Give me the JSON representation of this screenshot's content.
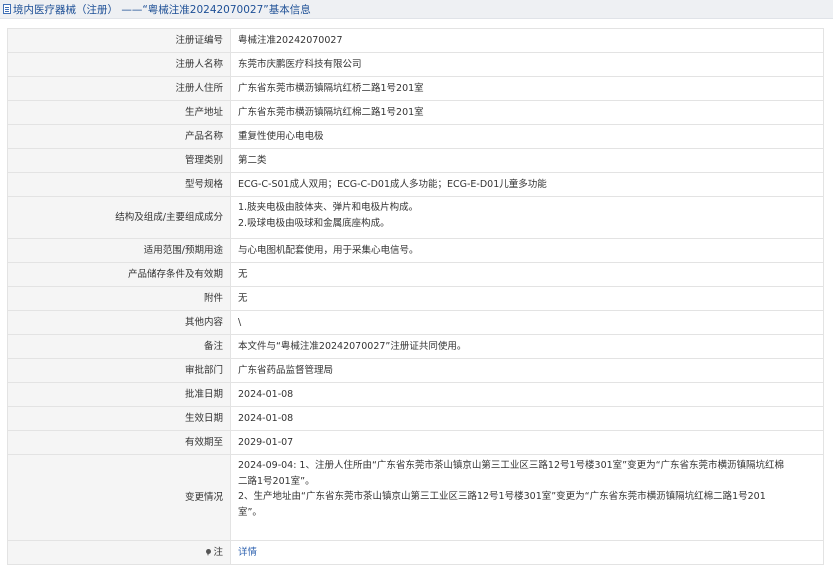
{
  "header": {
    "icon": "document-icon",
    "title": "境内医疗器械（注册） ——“粤械注准20242070027”基本信息"
  },
  "fields": [
    {
      "label": "注册证编号",
      "value": "粤械注准20242070027"
    },
    {
      "label": "注册人名称",
      "value": "东莞市庆鹏医疗科技有限公司"
    },
    {
      "label": "注册人住所",
      "value": "广东省东莞市横沥镇隔坑红桥二路1号201室"
    },
    {
      "label": "生产地址",
      "value": "广东省东莞市横沥镇隔坑红棉二路1号201室"
    },
    {
      "label": "产品名称",
      "value": "重复性使用心电电极"
    },
    {
      "label": "管理类别",
      "value": "第二类"
    },
    {
      "label": "型号规格",
      "value": "ECG-C-S01成人双用；ECG-C-D01成人多功能；ECG-E-D01儿童多功能"
    },
    {
      "label": "结构及组成/主要组成成分",
      "lines": [
        "1.肢夹电极由肢体夹、弹片和电极片构成。",
        "2.吸球电极由吸球和金属底座构成。"
      ]
    },
    {
      "label": "适用范围/预期用途",
      "value": "与心电图机配套使用，用于采集心电信号。"
    },
    {
      "label": "产品储存条件及有效期",
      "value": "无"
    },
    {
      "label": "附件",
      "value": "无"
    },
    {
      "label": "其他内容",
      "value": "\\"
    },
    {
      "label": "备注",
      "value": "本文件与“粤械注准20242070027”注册证共同使用。"
    },
    {
      "label": "审批部门",
      "value": "广东省药品监督管理局"
    },
    {
      "label": "批准日期",
      "value": "2024-01-08"
    },
    {
      "label": "生效日期",
      "value": "2024-01-08"
    },
    {
      "label": "有效期至",
      "value": "2029-01-07"
    },
    {
      "label": "变更情况",
      "lines": [
        "2024-09-04: 1、注册人住所由“广东省东莞市茶山镇京山第三工业区三路12号1号楼301室”变更为“广东省东莞市横沥镇隔坑红棉",
        "二路1号201室”。",
        "2、生产地址由“广东省东莞市茶山镇京山第三工业区三路12号1号楼301室”变更为“广东省东莞市横沥镇隔坑红棉二路1号201",
        "室”。"
      ]
    },
    {
      "label": "注",
      "icon": "pin-icon",
      "link": "详情"
    }
  ]
}
